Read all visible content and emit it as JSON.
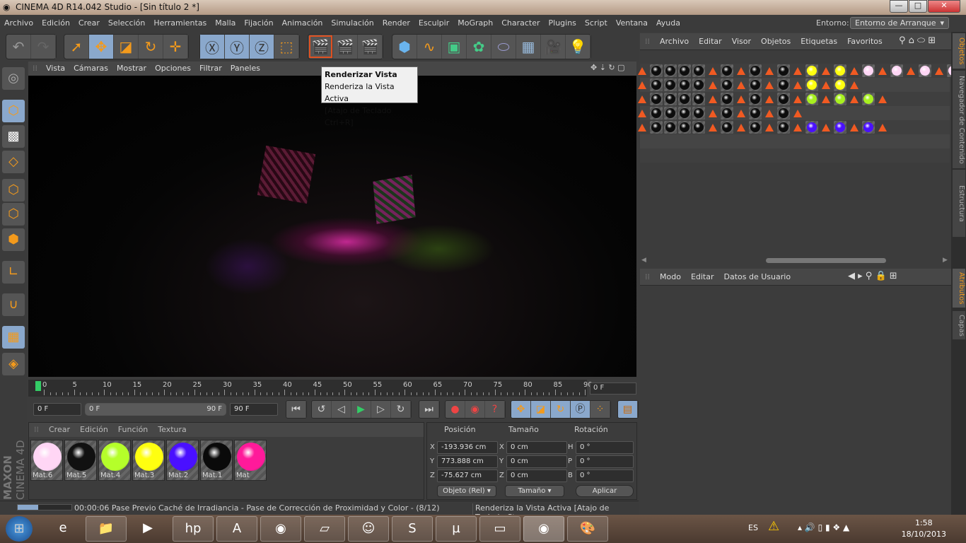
{
  "window": {
    "title": "CINEMA 4D R14.042 Studio - [Sin título 2 *]",
    "minimize": "—",
    "maximize": "□",
    "close": "✕"
  },
  "menu": [
    "Archivo",
    "Edición",
    "Crear",
    "Selección",
    "Herramientas",
    "Malla",
    "Fijación",
    "Animación",
    "Simulación",
    "Render",
    "Esculpir",
    "MoGraph",
    "Character",
    "Plugins",
    "Script",
    "Ventana",
    "Ayuda"
  ],
  "environment": {
    "label": "Entorno:",
    "value": "Entorno de Arranque"
  },
  "viewport": {
    "menu": [
      "Vista",
      "Cámaras",
      "Mostrar",
      "Opciones",
      "Filtrar",
      "Paneles"
    ]
  },
  "tooltip": {
    "title": "Renderizar Vista",
    "desc": "Renderiza la Vista Activa",
    "shortcut": "[Atajo de Teclado Ctrl+R]"
  },
  "timeline": {
    "ticks": [
      "0",
      "5",
      "10",
      "15",
      "20",
      "25",
      "30",
      "35",
      "40",
      "45",
      "50",
      "55",
      "60",
      "65",
      "70",
      "75",
      "80",
      "85",
      "90"
    ],
    "current_frame": "0 F",
    "start": "0 F",
    "range_start": "0 F",
    "range_end": "90 F",
    "end": "90 F"
  },
  "materials": {
    "menu": [
      "Crear",
      "Edición",
      "Función",
      "Textura"
    ],
    "items": [
      {
        "name": "Mat.6",
        "color": "#ffd6f5"
      },
      {
        "name": "Mat.5",
        "color": "#111111"
      },
      {
        "name": "Mat.4",
        "color": "#b5ff2a"
      },
      {
        "name": "Mat.3",
        "color": "#ffff10"
      },
      {
        "name": "Mat.2",
        "color": "#4a10ff"
      },
      {
        "name": "Mat.1",
        "color": "#0a0a0a"
      },
      {
        "name": "Mat",
        "color": "#ff1a9a"
      }
    ]
  },
  "coordinates": {
    "headers": [
      "Posición",
      "Tamaño",
      "Rotación"
    ],
    "rows": [
      {
        "a": "X",
        "pos": "-193.936 cm",
        "b": "X",
        "size": "0 cm",
        "c": "H",
        "rot": "0 °"
      },
      {
        "a": "Y",
        "pos": "773.888 cm",
        "b": "Y",
        "size": "0 cm",
        "c": "P",
        "rot": "0 °"
      },
      {
        "a": "Z",
        "pos": "-75.627 cm",
        "b": "Z",
        "size": "0 cm",
        "c": "B",
        "rot": "0 °"
      }
    ],
    "mode": "Objeto (Rel)",
    "size_mode": "Tamaño",
    "apply": "Aplicar"
  },
  "status": {
    "progress": 0.38,
    "text": "00:00:06 Pase Previo Caché de Irradiancia - Pase de Corrección de Proximidad y Color - (8/12)",
    "hint": "Renderiza la Vista Activa [Atajo de Teclado Ct"
  },
  "objects": {
    "menu": [
      "Archivo",
      "Editar",
      "Visor",
      "Objetos",
      "Etiquetas",
      "Favoritos"
    ],
    "rows": [
      "tbbbbtbtbtbtytytptptptp",
      "tbbbbtbtbtbtytyt",
      "tbbbbtbtbtbtgtgtgt",
      "tbbbbtbtbtbt",
      "tbbbbtbtbtbtvtvtvt"
    ],
    "tag_colors": {
      "b": "#0d0d0d",
      "y": "#ffff10",
      "g": "#a8f020",
      "v": "#4a10ff",
      "p": "#ffd6f5"
    }
  },
  "attributes": {
    "menu": [
      "Modo",
      "Editar",
      "Datos de Usuario"
    ]
  },
  "side_tabs": [
    "Objetos",
    "Navegador de Contenido",
    "Estructura",
    "Atributos",
    "Capas"
  ],
  "logo": "MAXON CINEMA 4D",
  "taskbar": {
    "lang": "ES",
    "time": "1:58",
    "date": "18/10/2013"
  }
}
